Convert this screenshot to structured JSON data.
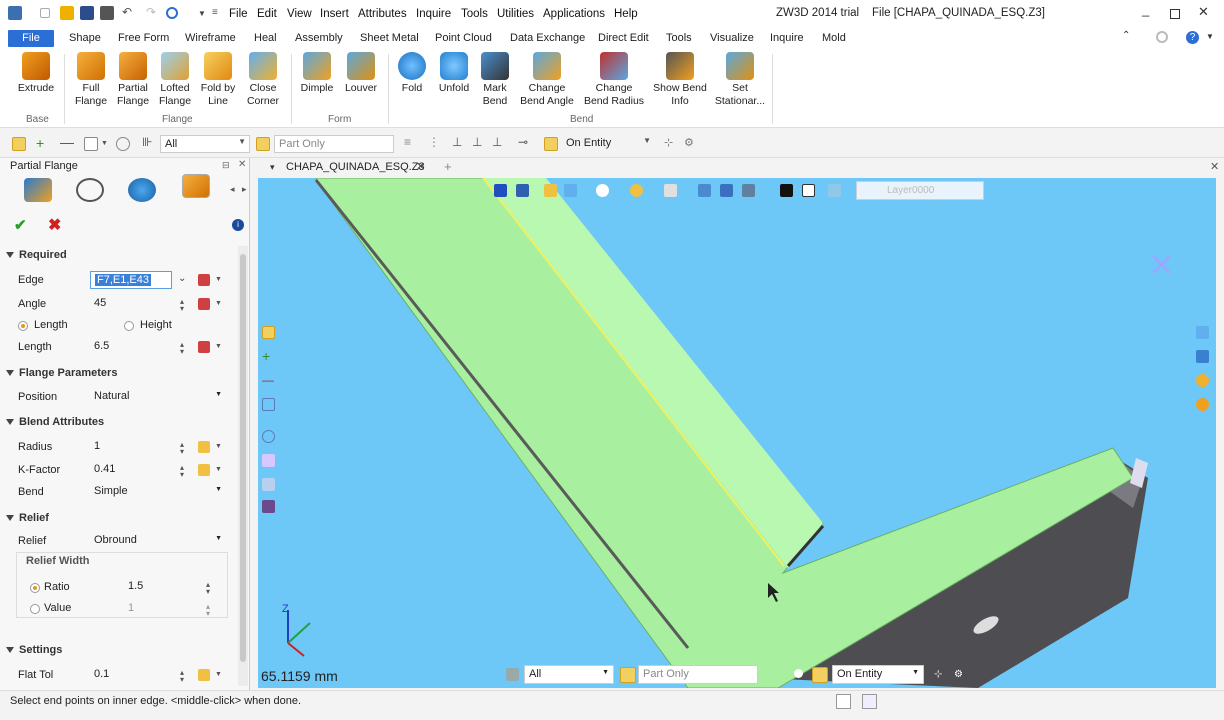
{
  "app": {
    "window_title": "ZW3D 2014 trial",
    "file_title": "File [CHAPA_QUINADA_ESQ.Z3]"
  },
  "menu": [
    "File",
    "Edit",
    "View",
    "Insert",
    "Attributes",
    "Inquire",
    "Tools",
    "Utilities",
    "Applications",
    "Help"
  ],
  "ribbon_tabs": [
    "File",
    "Shape",
    "Free Form",
    "Wireframe",
    "Heal",
    "Assembly",
    "Sheet Metal",
    "Point Cloud",
    "Data Exchange",
    "Direct Edit",
    "Tools",
    "Visualize",
    "Inquire",
    "Mold"
  ],
  "active_tab": "File",
  "ribbon": {
    "groups": [
      "Base",
      "Flange",
      "Form",
      "Bend"
    ],
    "buttons": [
      {
        "label": "Extrude",
        "icon": "extrude-icon"
      },
      {
        "label": "Full\nFlange",
        "icon": "full-flange-icon"
      },
      {
        "label": "Partial\nFlange",
        "icon": "partial-flange-icon"
      },
      {
        "label": "Lofted\nFlange",
        "icon": "lofted-flange-icon"
      },
      {
        "label": "Fold by\nLine",
        "icon": "fold-by-line-icon"
      },
      {
        "label": "Close\nCorner",
        "icon": "close-corner-icon"
      },
      {
        "label": "Dimple",
        "icon": "dimple-icon"
      },
      {
        "label": "Louver",
        "icon": "louver-icon"
      },
      {
        "label": "Fold",
        "icon": "fold-icon"
      },
      {
        "label": "Unfold",
        "icon": "unfold-icon"
      },
      {
        "label": "Mark\nBend",
        "icon": "mark-bend-icon"
      },
      {
        "label": "Change\nBend Angle",
        "icon": "change-bend-angle-icon"
      },
      {
        "label": "Change\nBend Radius",
        "icon": "change-bend-radius-icon"
      },
      {
        "label": "Show Bend\nInfo",
        "icon": "show-bend-info-icon"
      },
      {
        "label": "Set\nStationar...",
        "icon": "set-stationary-icon"
      }
    ]
  },
  "cmdbar": {
    "filter": "All",
    "scope": "Part Only",
    "pick_mode": "On Entity"
  },
  "panel": {
    "title": "Partial Flange",
    "required": {
      "header": "Required",
      "edge_label": "Edge",
      "edge_value": "F7,E1,E43",
      "angle_label": "Angle",
      "angle_value": "45",
      "length_option": "Length",
      "height_option": "Height",
      "length_label": "Length",
      "length_value": "6.5"
    },
    "flange_params": {
      "header": "Flange Parameters",
      "position_label": "Position",
      "position_value": "Natural"
    },
    "blend": {
      "header": "Blend Attributes",
      "radius_label": "Radius",
      "radius_value": "1",
      "kfactor_label": "K-Factor",
      "kfactor_value": "0.41",
      "bend_label": "Bend",
      "bend_value": "Simple"
    },
    "relief": {
      "header": "Relief",
      "relief_label": "Relief",
      "relief_value": "Obround",
      "width_header": "Relief Width",
      "ratio_label": "Ratio",
      "ratio_value": "1.5",
      "value_label": "Value",
      "value_value": "1"
    },
    "settings": {
      "header": "Settings",
      "flattol_label": "Flat Tol",
      "flattol_value": "0.1"
    }
  },
  "doc_tab": "CHAPA_QUINADA_ESQ.Z3",
  "viewport": {
    "layer": "Layer0000",
    "measure": "65.1159 mm",
    "filter": "All",
    "scope": "Part Only",
    "pick_mode": "On Entity",
    "colors": {
      "background": "#6dc8f8",
      "flange": "#a8f0a0",
      "body": "#5a5a5e"
    }
  },
  "status": {
    "message": "Select end points on inner edge. <middle-click> when done."
  }
}
